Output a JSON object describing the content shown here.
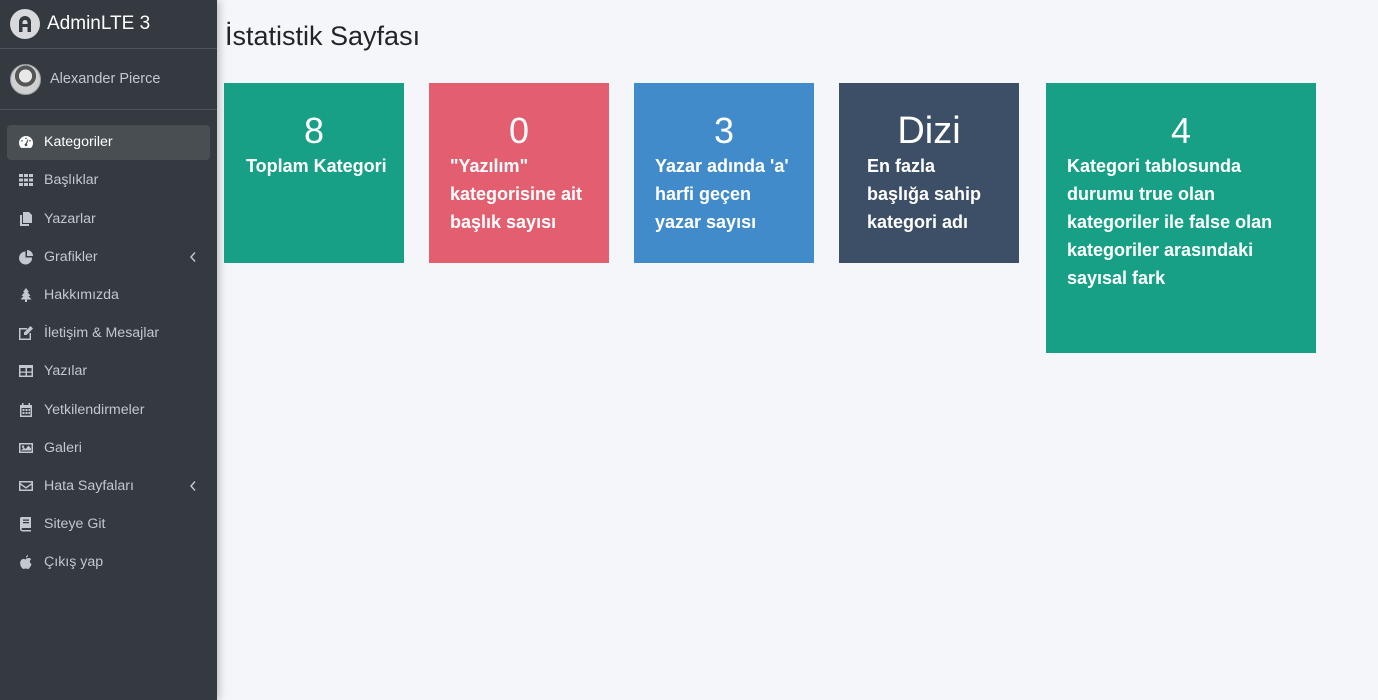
{
  "brand": {
    "name": "AdminLTE 3"
  },
  "user": {
    "name": "Alexander Pierce"
  },
  "sidebar": {
    "items": [
      {
        "label": "Kategoriler",
        "icon": "dashboard-icon",
        "active": true
      },
      {
        "label": "Başlıklar",
        "icon": "th-icon"
      },
      {
        "label": "Yazarlar",
        "icon": "copy-icon"
      },
      {
        "label": "Grafikler",
        "icon": "pie-chart-icon",
        "expandable": true
      },
      {
        "label": "Hakkımızda",
        "icon": "tree-icon"
      },
      {
        "label": "İletişim & Mesajlar",
        "icon": "edit-icon"
      },
      {
        "label": "Yazılar",
        "icon": "table-icon"
      },
      {
        "label": "Yetkilendirmeler",
        "icon": "calendar-icon"
      },
      {
        "label": "Galeri",
        "icon": "image-icon"
      },
      {
        "label": "Hata Sayfaları",
        "icon": "envelope-icon",
        "expandable": true
      },
      {
        "label": "Siteye Git",
        "icon": "book-icon"
      },
      {
        "label": "Çıkış yap",
        "icon": "apple-icon"
      }
    ]
  },
  "page": {
    "title": "İstatistik Sayfası"
  },
  "stats": [
    {
      "value": "8",
      "label": "Toplam Kategori",
      "color": "#17a085"
    },
    {
      "value": "0",
      "label": "\"Yazılım\" kategorisine ait başlık sayısı",
      "color": "#e35f70"
    },
    {
      "value": "3",
      "label": "Yazar adında 'a' harfi geçen yazar sayısı",
      "color": "#428bca"
    },
    {
      "value": "Dizi",
      "label": "En fazla başlığa sahip kategori adı",
      "color": "#3d4f66"
    },
    {
      "value": "4",
      "label": "Kategori tablosunda durumu true olan kategoriler ile false olan kategoriler arasındaki sayısal fark",
      "color": "#17a085"
    }
  ]
}
